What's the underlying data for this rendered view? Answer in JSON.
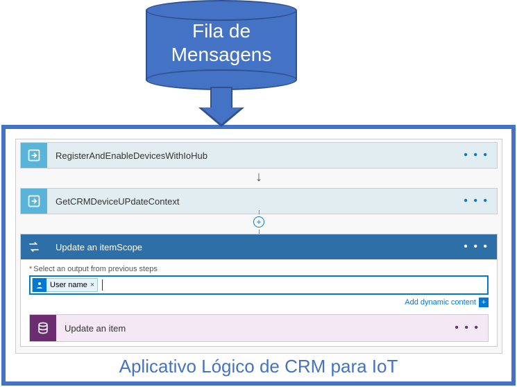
{
  "cylinder": {
    "label": "Fila de Mensagens"
  },
  "steps": [
    {
      "title": "RegisterAndEnableDevicesWithIoHub",
      "icon": "flow-icon",
      "color": "#59b4d9"
    },
    {
      "title": "GetCRMDeviceUPdateContext",
      "icon": "flow-icon",
      "color": "#59b4d9"
    }
  ],
  "scope": {
    "title": "Update an itemScope",
    "field_label": "Select an output from previous steps",
    "required_mark": "*",
    "chip": {
      "label": "User name",
      "close": "×"
    },
    "dynamic_link": "Add dynamic content",
    "substep": {
      "title": "Update an item",
      "icon": "database-icon"
    }
  },
  "caption": "Aplicativo Lógico de CRM para IoT",
  "colors": {
    "primary": "#4472c4",
    "accent": "#0078d4",
    "scope": "#2f6fa7",
    "db": "#6b2c70"
  }
}
